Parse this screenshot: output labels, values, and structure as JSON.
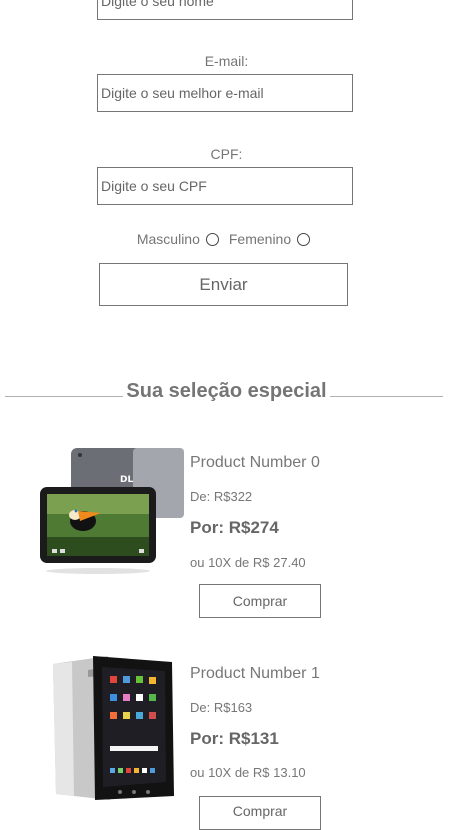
{
  "form": {
    "name_placeholder": "Digite o seu nome",
    "email_label": "E-mail:",
    "email_placeholder": "Digite o seu melhor e-mail",
    "cpf_label": "CPF:",
    "cpf_placeholder": "Digite o seu CPF",
    "gender_male": "Masculino",
    "gender_female": "Femenino",
    "submit_label": "Enviar"
  },
  "section": {
    "title": "Sua seleção especial"
  },
  "products": [
    {
      "name": "Product Number 0",
      "price_from": "De: R$322",
      "price_to": "Por: R$274",
      "installments": "ou 10X de R$ 27.40",
      "buy_label": "Comprar",
      "image_icon": "tablet-toucan-image"
    },
    {
      "name": "Product Number 1",
      "price_from": "De: R$163",
      "price_to": "Por: R$131",
      "installments": "ou 10X de R$ 13.10",
      "buy_label": "Comprar",
      "image_icon": "tablet-apps-image"
    }
  ]
}
